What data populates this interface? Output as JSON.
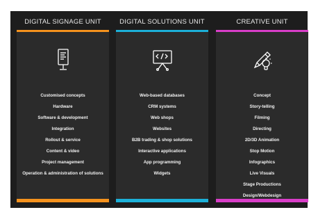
{
  "colors": {
    "background": "#1d1d1d",
    "card": "#2b2b2b",
    "signage_accent": "#f5921d",
    "solutions_accent": "#1cb0d8",
    "creative_accent": "#d93ec8"
  },
  "columns": [
    {
      "title": "DIGITAL SIGNAGE UNIT",
      "icon": "signage-kiosk-icon",
      "items": [
        "Customised concepts",
        "Hardware",
        "Software & development",
        "Integration",
        "Rollout & service",
        "Content & video",
        "Project management",
        "Operation & administration of solutions"
      ]
    },
    {
      "title": "DIGITAL SOLUTIONS UNIT",
      "icon": "code-monitor-icon",
      "items": [
        "Web-based databases",
        "CRM systems",
        "Web shops",
        "Websites",
        "B2B trading & shop solutions",
        "Interactive applications",
        "App programming",
        "Widgets"
      ]
    },
    {
      "title": "CREATIVE UNIT",
      "icon": "pencil-bulb-icon",
      "items": [
        "Concept",
        "Story-telling",
        "Filming",
        "Directing",
        "2D/3D Animation",
        "Stop Motion",
        "Infographics",
        "Live Visuals",
        "Stage Productions",
        "Design/Webdesign"
      ]
    }
  ]
}
